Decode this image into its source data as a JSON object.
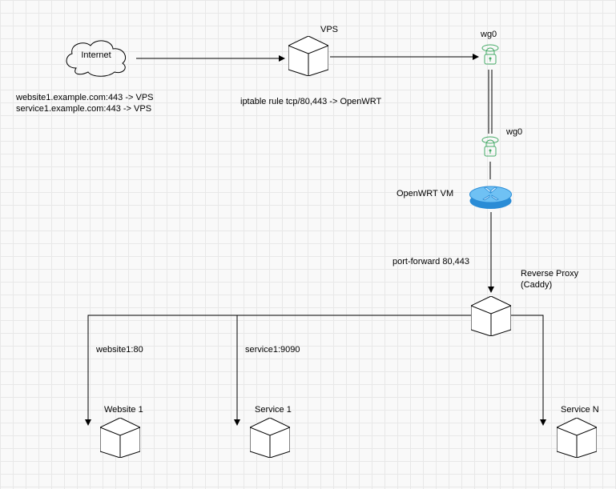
{
  "internet": {
    "label": "Internet"
  },
  "dns_lines": {
    "line1": "website1.example.com:443 -> VPS",
    "line2": "service1.example.com:443 -> VPS"
  },
  "vps": {
    "label": "VPS"
  },
  "iptables_text": "iptable rule tcp/80,443 -> OpenWRT",
  "wg0_top": "wg0",
  "wg0_bottom": "wg0",
  "openwrt": {
    "label": "OpenWRT VM"
  },
  "port_forward": "port-forward 80,443",
  "reverse_proxy": {
    "line1": "Reverse Proxy",
    "line2": "(Caddy)"
  },
  "edge_website1": "website1:80",
  "edge_service1": "service1:9090",
  "website1": {
    "label": "Website 1"
  },
  "service1": {
    "label": "Service 1"
  },
  "serviceN": {
    "label": "Service N"
  }
}
